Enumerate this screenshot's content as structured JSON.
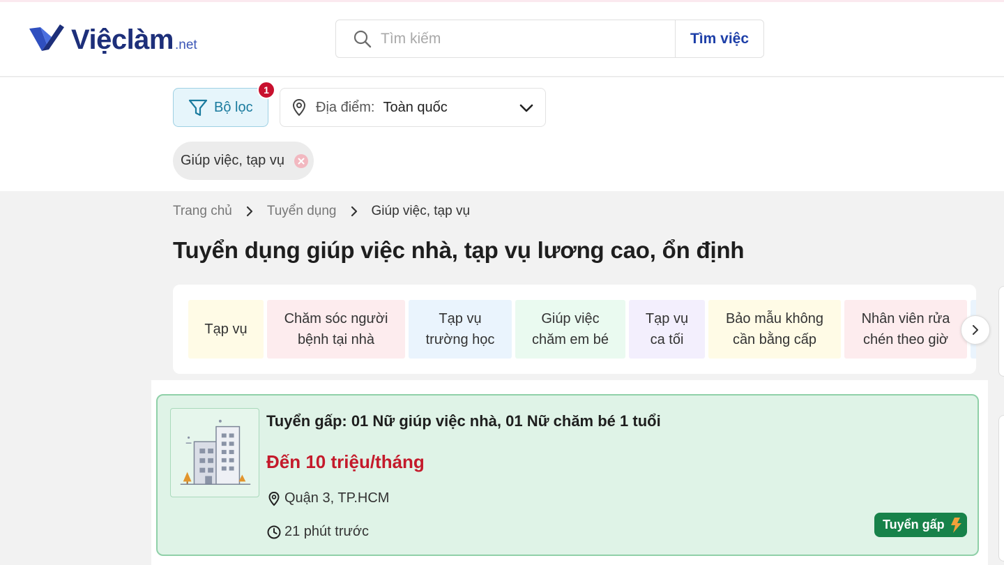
{
  "header": {
    "logo_text": "Việclàm",
    "logo_suffix": ".net",
    "search_placeholder": "Tìm kiếm",
    "search_button": "Tìm việc"
  },
  "filters": {
    "filter_button": "Bộ lọc",
    "filter_count": "1",
    "location_label": "Địa điểm:",
    "location_value": "Toàn quốc",
    "active_chip": "Giúp việc, tạp vụ"
  },
  "breadcrumb": {
    "items": [
      "Trang chủ",
      "Tuyển dụng"
    ],
    "current": "Giúp việc, tạp vụ"
  },
  "page_title": "Tuyển dụng giúp việc nhà, tạp vụ lương cao, ổn định",
  "categories": [
    {
      "label": "Tạp vụ",
      "color": "#fffbe6"
    },
    {
      "label": "Chăm sóc người bệnh tại nhà",
      "color": "#fdecee"
    },
    {
      "label": "Tạp vụ trường học",
      "color": "#eaf4fd"
    },
    {
      "label": "Giúp việc chăm em bé",
      "color": "#eafaf0"
    },
    {
      "label": "Tạp vụ ca tối",
      "color": "#f3effd"
    },
    {
      "label": "Bảo mẫu không cần bằng cấp",
      "color": "#fffbe6"
    },
    {
      "label": "Nhân viên rửa chén theo giờ",
      "color": "#fdecee"
    }
  ],
  "job": {
    "title": "Tuyển gấp: 01 Nữ giúp việc nhà, 01 Nữ chăm bé 1 tuổi",
    "salary": "Đến 10 triệu/tháng",
    "location": "Quận 3, TP.HCM",
    "posted": "21 phút trước",
    "badge": "Tuyển gấp"
  },
  "colors": {
    "brand": "#1d2f7a",
    "salary": "#c41a2b",
    "badge": "#17824a",
    "card_bg": "#dff3e7"
  }
}
